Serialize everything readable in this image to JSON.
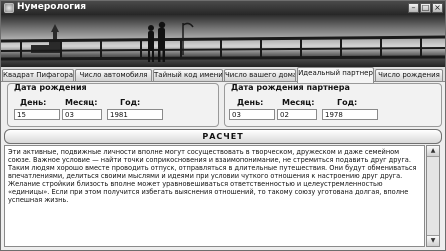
{
  "window": {
    "title": "Нумерология",
    "buttons": {
      "minimize": "–",
      "maximize": "□",
      "close": "×"
    }
  },
  "tabs": [
    {
      "label": "Квадрат Пифагора"
    },
    {
      "label": "Число автомобиля"
    },
    {
      "label": "Тайный код имени"
    },
    {
      "label": "Число вашего дома"
    },
    {
      "label": "Идеальный партнер"
    },
    {
      "label": "Число рождения"
    }
  ],
  "active_tab": "Идеальный партнер",
  "birth": {
    "title": "Дата рождения",
    "day_label": "День:",
    "month_label": "Месяц:",
    "year_label": "Год:",
    "day": "15",
    "month": "03",
    "year": "1981"
  },
  "partner": {
    "title": "Дата рождения партнера",
    "day_label": "День:",
    "month_label": "Месяц:",
    "year_label": "Год:",
    "day": "03",
    "month": "02",
    "year": "1978"
  },
  "calc_button": "РАСЧЕТ",
  "result_text": "Эти активные, подвижные личности вполне могут сосуществовать в творческом, дружеском и даже семейном союзе. Важное условие — найти точки соприкосновения и взаимопонимание, не стремиться подавить друг друга. Таким людям хорошо вместе проводить отпуск, отправляться в длительные путешествия. Они будут обмениваться впечатлениями, делиться своими мыслями и идеями при условии чуткого отношения к настроению друг друга. Желание стройкии близость вполне может уравновешиваться ответственностью и целеустремленностью «единицы». Если при этом получится избегать выяснения отношений, то такому союзу уготована долгая, вполне успешная жизнь.",
  "colors": {
    "titlebar": "#333333",
    "window_bg": "#eeeeee",
    "border": "#8a8a8a"
  }
}
